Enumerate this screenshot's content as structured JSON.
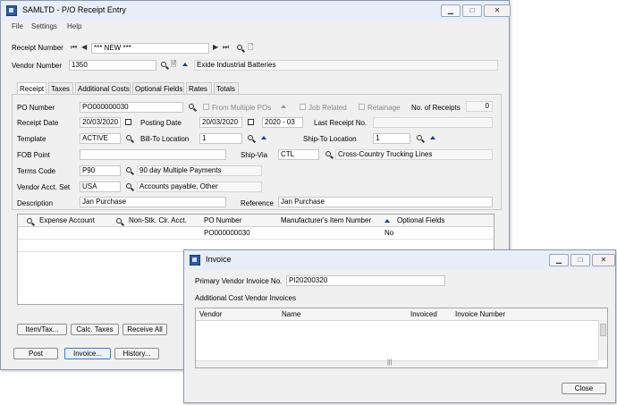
{
  "main_window": {
    "title": "SAMLTD - P/O Receipt Entry",
    "menu": [
      "File",
      "Settings",
      "Help"
    ],
    "receipt_number_label": "Receipt Number",
    "receipt_number_value": "*** NEW ***",
    "vendor_number_label": "Vendor Number",
    "vendor_number_value": "1350",
    "vendor_name": "Exide Industrial Batteries",
    "tabs": [
      "Receipt",
      "Taxes",
      "Additional Costs",
      "Optional Fields",
      "Rates",
      "Totals"
    ],
    "po_number_label": "PO Number",
    "po_number_value": "PO000000030",
    "from_multiple_pos": "From Multiple POs",
    "job_related": "Job Related",
    "retainage": "Retainage",
    "no_of_receipts_label": "No. of Receipts",
    "no_of_receipts_value": "0",
    "receipt_date_label": "Receipt Date",
    "receipt_date_value": "20/03/2020",
    "posting_date_label": "Posting Date",
    "posting_date_value": "20/03/2020",
    "fiscal_period": "2020 - 03",
    "last_receipt_label": "Last Receipt No.",
    "template_label": "Template",
    "template_value": "ACTIVE",
    "bill_to_label": "Bill-To Location",
    "bill_to_value": "1",
    "ship_to_label": "Ship-To Location",
    "ship_to_value": "1",
    "fob_label": "FOB Point",
    "ship_via_label": "Ship-Via",
    "ship_via_value": "CTL",
    "ship_via_desc": "Cross-Country Trucking Lines",
    "terms_label": "Terms Code",
    "terms_value": "P90",
    "terms_desc": "90 day Multiple Payments",
    "vendor_acct_label": "Vendor Acct. Set",
    "vendor_acct_value": "USA",
    "vendor_acct_desc": "Accounts payable, Other",
    "description_label": "Description",
    "description_value": "Jan Purchase",
    "reference_label": "Reference",
    "reference_value": "Jan Purchase",
    "grid_headers": [
      "Expense Account",
      "Non-Stk. Clr. Acct.",
      "PO Number",
      "Manufacturer's Item Number",
      "Optional Fields"
    ],
    "grid_row": {
      "po_number": "PO000000030",
      "optional_fields": "No"
    },
    "buttons": {
      "item_tax": "Item/Tax...",
      "calc_taxes": "Calc. Taxes",
      "receive_all": "Receive All",
      "post": "Post",
      "invoice": "Invoice...",
      "history": "History..."
    }
  },
  "invoice_window": {
    "title": "Invoice",
    "primary_label": "Primary Vendor Invoice No.",
    "primary_value": "PI20200320",
    "additional_label": "Additional Cost Vendor Invoices",
    "headers": [
      "Vendor",
      "Name",
      "Invoiced",
      "Invoice Number"
    ],
    "close": "Close"
  }
}
